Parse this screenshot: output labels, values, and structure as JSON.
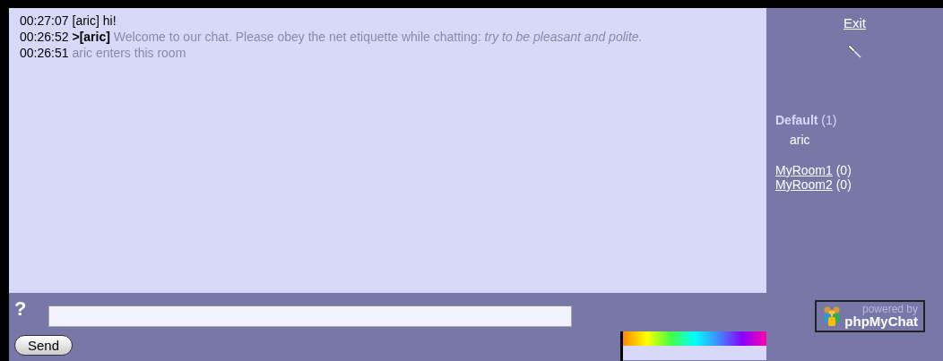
{
  "messages": [
    {
      "time": "00:27:07",
      "user": "[aric]",
      "kind": "user",
      "text": "hi!"
    },
    {
      "time": "00:26:52",
      "user": ">[aric]",
      "kind": "notice",
      "text": "Welcome to our chat. Please obey the net etiquette while chatting: *try to be pleasant and polite.*"
    },
    {
      "time": "00:26:51",
      "kind": "system",
      "text": "aric enters this room"
    }
  ],
  "sidebar": {
    "exit": "Exit",
    "rooms": [
      {
        "name": "Default",
        "count": "(1)",
        "current": true,
        "users": [
          "aric"
        ]
      },
      {
        "name": "MyRoom1",
        "count": "(0)",
        "current": false
      },
      {
        "name": "MyRoom2",
        "count": "(0)",
        "current": false
      }
    ]
  },
  "input": {
    "help": "?",
    "send": "Send"
  },
  "logo": {
    "tagline": "powered by",
    "name": "phpMyChat"
  }
}
